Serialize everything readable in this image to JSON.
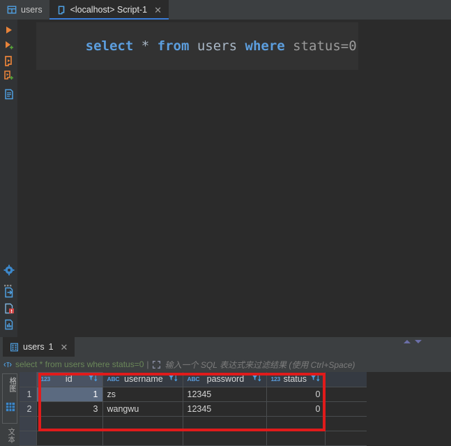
{
  "window": {
    "tabs": [
      {
        "label": "users",
        "icon": "table-icon",
        "active": false,
        "closable": false
      },
      {
        "label": "<localhost> Script-1",
        "icon": "script-file-icon",
        "active": true,
        "closable": true,
        "close_label": "✕"
      }
    ]
  },
  "editor": {
    "gutter_icons": [
      "run-statement-icon",
      "run-statement-add-icon",
      "run-script-icon",
      "run-script-add-icon",
      "sql-file-icon",
      "settings-gear-icon",
      "more-dots-icon",
      "export-data-icon",
      "error-file-icon",
      "analyze-file-icon"
    ],
    "code_tokens": [
      {
        "text": "select",
        "type": "keyword"
      },
      {
        "text": " ",
        "type": "plain"
      },
      {
        "text": "*",
        "type": "operator"
      },
      {
        "text": " ",
        "type": "plain"
      },
      {
        "text": "from",
        "type": "keyword"
      },
      {
        "text": " ",
        "type": "plain"
      },
      {
        "text": "users",
        "type": "identifier"
      },
      {
        "text": " ",
        "type": "plain"
      },
      {
        "text": "where",
        "type": "keyword"
      },
      {
        "text": " ",
        "type": "plain"
      },
      {
        "text": "status=0",
        "type": "plain"
      }
    ]
  },
  "results": {
    "tab": {
      "icon": "result-table-icon",
      "label": "users",
      "count": "1",
      "close_label": "✕"
    },
    "nav_up": "▲",
    "nav_down": "▼",
    "filter": {
      "icon": "sql-filter-icon",
      "query": "select * from users where status=0",
      "separator": "|",
      "expand_icon": "expand-icon",
      "placeholder": "输入一个 SQL 表达式来过滤结果 (使用 Ctrl+Space)"
    },
    "sidebar": {
      "label_top": "格图",
      "grid_icon": "grid-view-icon",
      "label_bottom": "文本"
    },
    "grid": {
      "columns": [
        {
          "name": "id",
          "type_badge": "123",
          "type_kind": "number",
          "filter_icon": "column-filter-icon",
          "selected": true
        },
        {
          "name": "username",
          "type_badge": "ABC",
          "type_kind": "text",
          "filter_icon": "column-filter-icon",
          "selected": false
        },
        {
          "name": "password",
          "type_badge": "ABC",
          "type_kind": "text",
          "filter_icon": "column-filter-icon",
          "selected": false
        },
        {
          "name": "status",
          "type_badge": "123",
          "type_kind": "number",
          "filter_icon": "column-filter-icon",
          "selected": false
        }
      ],
      "rows": [
        {
          "num": "1",
          "cells": [
            "1",
            "zs",
            "12345",
            "0"
          ],
          "selected_cell": 0
        },
        {
          "num": "2",
          "cells": [
            "3",
            "wangwu",
            "12345",
            "0"
          ],
          "selected_cell": -1
        }
      ]
    }
  },
  "annotation": {
    "highlight_color": "#e01b1b"
  },
  "colors": {
    "accent_blue": "#3b7dd8",
    "keyword_blue": "#5c9ede",
    "sql_green": "#6a8759",
    "tab_bg": "#3c3f41",
    "editor_bg": "#2b2b2b",
    "grid_header_bg": "#353a42",
    "selection_bg": "#5b6a80"
  }
}
